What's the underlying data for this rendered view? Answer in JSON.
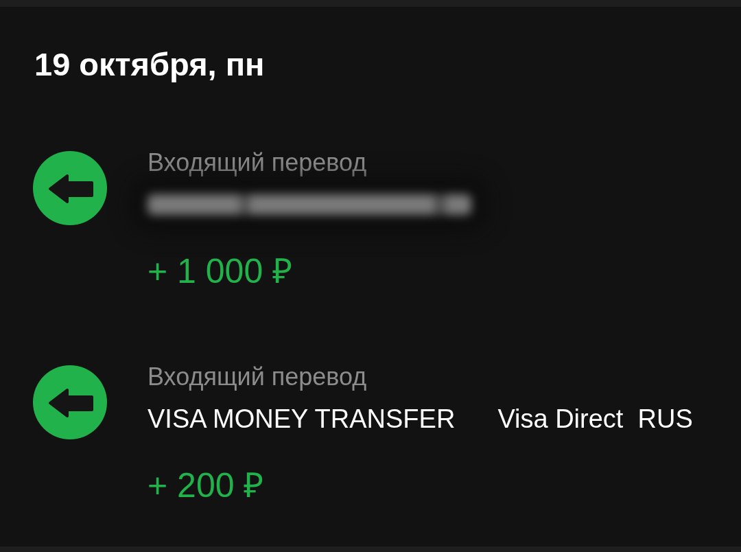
{
  "date_heading": "19 октября, пн",
  "transactions": [
    {
      "title": "Входящий перевод",
      "counterparty": {
        "kind": "blurred"
      },
      "amount": "+ 1 000 ₽"
    },
    {
      "title": "Входящий перевод",
      "counterparty": {
        "kind": "text",
        "parts": [
          "VISA MONEY TRANSFER",
          "Visa Direct  RUS"
        ]
      },
      "amount": "+ 200 ₽"
    }
  ]
}
